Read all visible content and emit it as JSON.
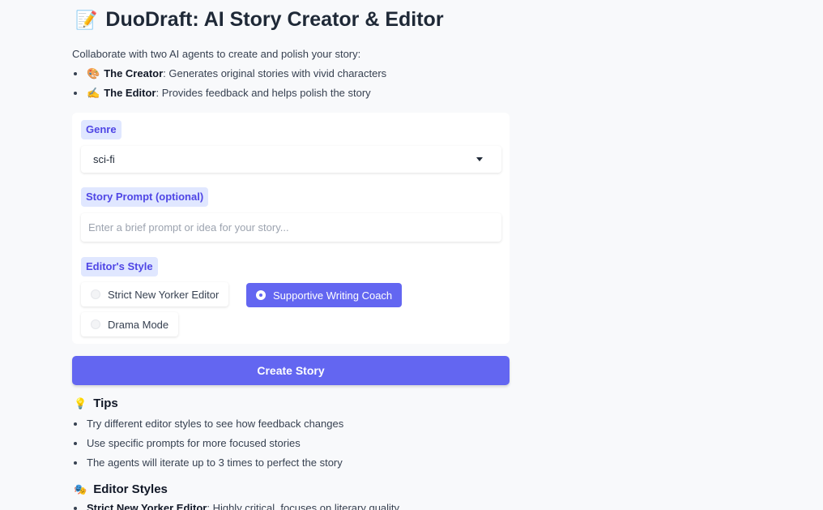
{
  "header": {
    "icon": "memo-icon",
    "title": "DuoDraft: AI Story Creator & Editor"
  },
  "intro": {
    "text": "Collaborate with two AI agents to create and polish your story:",
    "agents": [
      {
        "emoji": "🎨",
        "name": "The Creator",
        "desc": ": Generates original stories with vivid characters"
      },
      {
        "emoji": "✍️",
        "name": "The Editor",
        "desc": ": Provides feedback and helps polish the story"
      }
    ]
  },
  "form": {
    "genre_label": "Genre",
    "genre_value": "sci-fi",
    "prompt_label": "Story Prompt (optional)",
    "prompt_placeholder": "Enter a brief prompt or idea for your story...",
    "prompt_value": "",
    "style_label": "Editor's Style",
    "style_options": [
      "Strict New Yorker Editor",
      "Supportive Writing Coach",
      "Drama Mode"
    ],
    "style_selected": "Supportive Writing Coach",
    "create_label": "Create Story"
  },
  "tips": {
    "emoji": "💡",
    "title": "Tips",
    "items": [
      "Try different editor styles to see how feedback changes",
      "Use specific prompts for more focused stories",
      "The agents will iterate up to 3 times to perfect the story"
    ]
  },
  "styles_section": {
    "emoji": "🎭",
    "title": "Editor Styles",
    "items": [
      {
        "name": "Strict New Yorker Editor",
        "desc": ": Highly critical, focuses on literary quality"
      }
    ]
  },
  "colors": {
    "accent": "#6366f1",
    "label_bg": "#e0e7ff",
    "label_text": "#4f46e5",
    "background": "#f8f9fb"
  }
}
